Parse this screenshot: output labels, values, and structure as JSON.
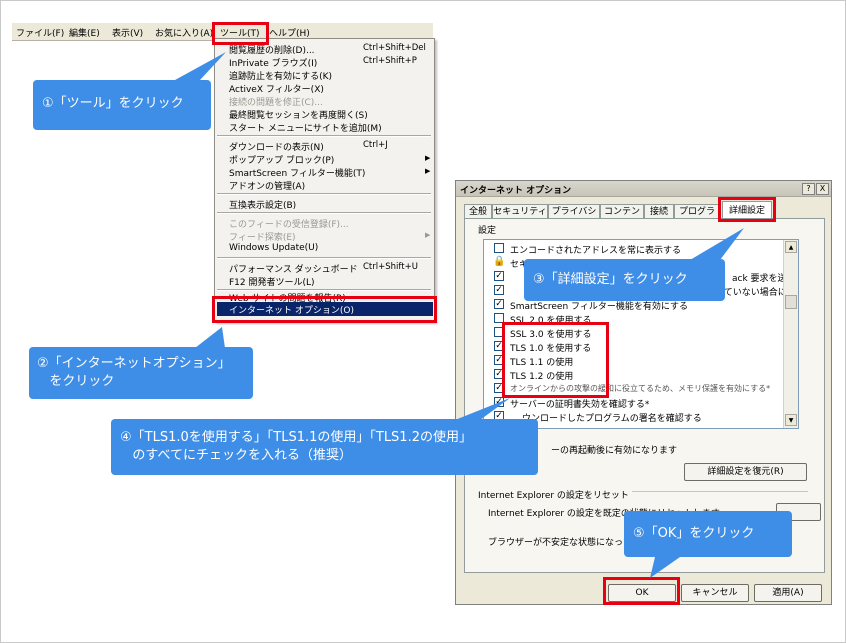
{
  "menubar": {
    "items": [
      "ファイル(F)",
      "編集(E)",
      "表示(V)",
      "お気に入り(A)",
      "ツール(T)",
      "ヘルプ(H)"
    ]
  },
  "tools_menu": {
    "items": [
      {
        "label": "閲覧履歴の削除(D)...",
        "shortcut": "Ctrl+Shift+Del"
      },
      {
        "label": "InPrivate ブラウズ(I)",
        "shortcut": "Ctrl+Shift+P"
      },
      {
        "label": "追跡防止を有効にする(K)",
        "shortcut": ""
      },
      {
        "label": "ActiveX フィルター(X)",
        "shortcut": ""
      },
      {
        "label": "接続の問題を修正(C)...",
        "shortcut": ""
      },
      {
        "label": "最終閲覧セッションを再度開く(S)",
        "shortcut": ""
      },
      {
        "label": "スタート メニューにサイトを追加(M)",
        "shortcut": ""
      },
      {
        "label": "ダウンロードの表示(N)",
        "shortcut": "Ctrl+J"
      },
      {
        "label": "ポップアップ ブロック(P)",
        "shortcut": ""
      },
      {
        "label": "SmartScreen フィルター機能(T)",
        "shortcut": ""
      },
      {
        "label": "アドオンの管理(A)",
        "shortcut": ""
      },
      {
        "label": "互換表示設定(B)",
        "shortcut": ""
      },
      {
        "label": "このフィードの受信登録(F)...",
        "shortcut": ""
      },
      {
        "label": "フィード探索(E)",
        "shortcut": ""
      },
      {
        "label": "Windows Update(U)",
        "shortcut": ""
      },
      {
        "label": "パフォーマンス ダッシュボード",
        "shortcut": "Ctrl+Shift+U"
      },
      {
        "label": "F12 開発者ツール(L)",
        "shortcut": ""
      },
      {
        "label": "Web サイトの問題を報告(R)",
        "shortcut": ""
      },
      {
        "label": "インターネット オプション(O)",
        "shortcut": ""
      }
    ]
  },
  "callouts": {
    "step1": "①「ツール」をクリック",
    "step2": "②「インターネットオプション」\n   をクリック",
    "step3": "③「詳細設定」をクリック",
    "step4": "④「TLS1.0を使用する」「TLS1.1の使用」「TLS1.2の使用」\n   のすべてにチェックを入れる（推奨）",
    "step5": "⑤「OK」をクリック"
  },
  "dialog": {
    "title": "インターネット オプション",
    "help_button": "?",
    "close_button": "X",
    "tabs": [
      "全般",
      "セキュリティ",
      "プライバシー",
      "コンテンツ",
      "接続",
      "プログラム",
      "詳細設定"
    ],
    "settings_label": "設定",
    "list_items": [
      {
        "label": "エンコードされたアドレスを常に表示する",
        "checked": false
      },
      {
        "label": "セキ",
        "checked": null
      },
      {
        "label": "ack 要求を送",
        "checked": true
      },
      {
        "label": "されていない場合に",
        "checked": true
      },
      {
        "label": "SmartScreen フィルター機能を有効にする",
        "checked": true
      },
      {
        "label": "SSL 2.0 を使用する",
        "checked": false
      },
      {
        "label": "SSL 3.0 を使用する",
        "checked": false
      },
      {
        "label": "TLS 1.0 を使用する",
        "checked": true
      },
      {
        "label": "TLS 1.1 の使用",
        "checked": true
      },
      {
        "label": "TLS 1.2 の使用",
        "checked": true
      },
      {
        "label": "オンラインからの攻撃の緩和に役立てるため、メモリ保護を有効にする*",
        "checked": true
      },
      {
        "label": "サーバーの証明書失効を確認する*",
        "checked": true
      },
      {
        "label": "ウンロードしたプログラムの署名を確認する",
        "checked": true
      }
    ],
    "restart_note": "ーの再起動後に有効になります",
    "restore_button": "詳細設定を復元(R)",
    "reset_group_label": "Internet Explorer の設定をリセット",
    "reset_text1": "Internet Explorer の設定を既定の状態にリセットします",
    "reset_text2": "ブラウザーが不安定な状態になった場",
    "ok_button": "OK",
    "cancel_button": "キャンセル",
    "apply_button": "適用(A)"
  },
  "colors": {
    "callout": "#3e8ee8",
    "highlight_box": "#e60012",
    "menu_selected": "#0a246a"
  }
}
